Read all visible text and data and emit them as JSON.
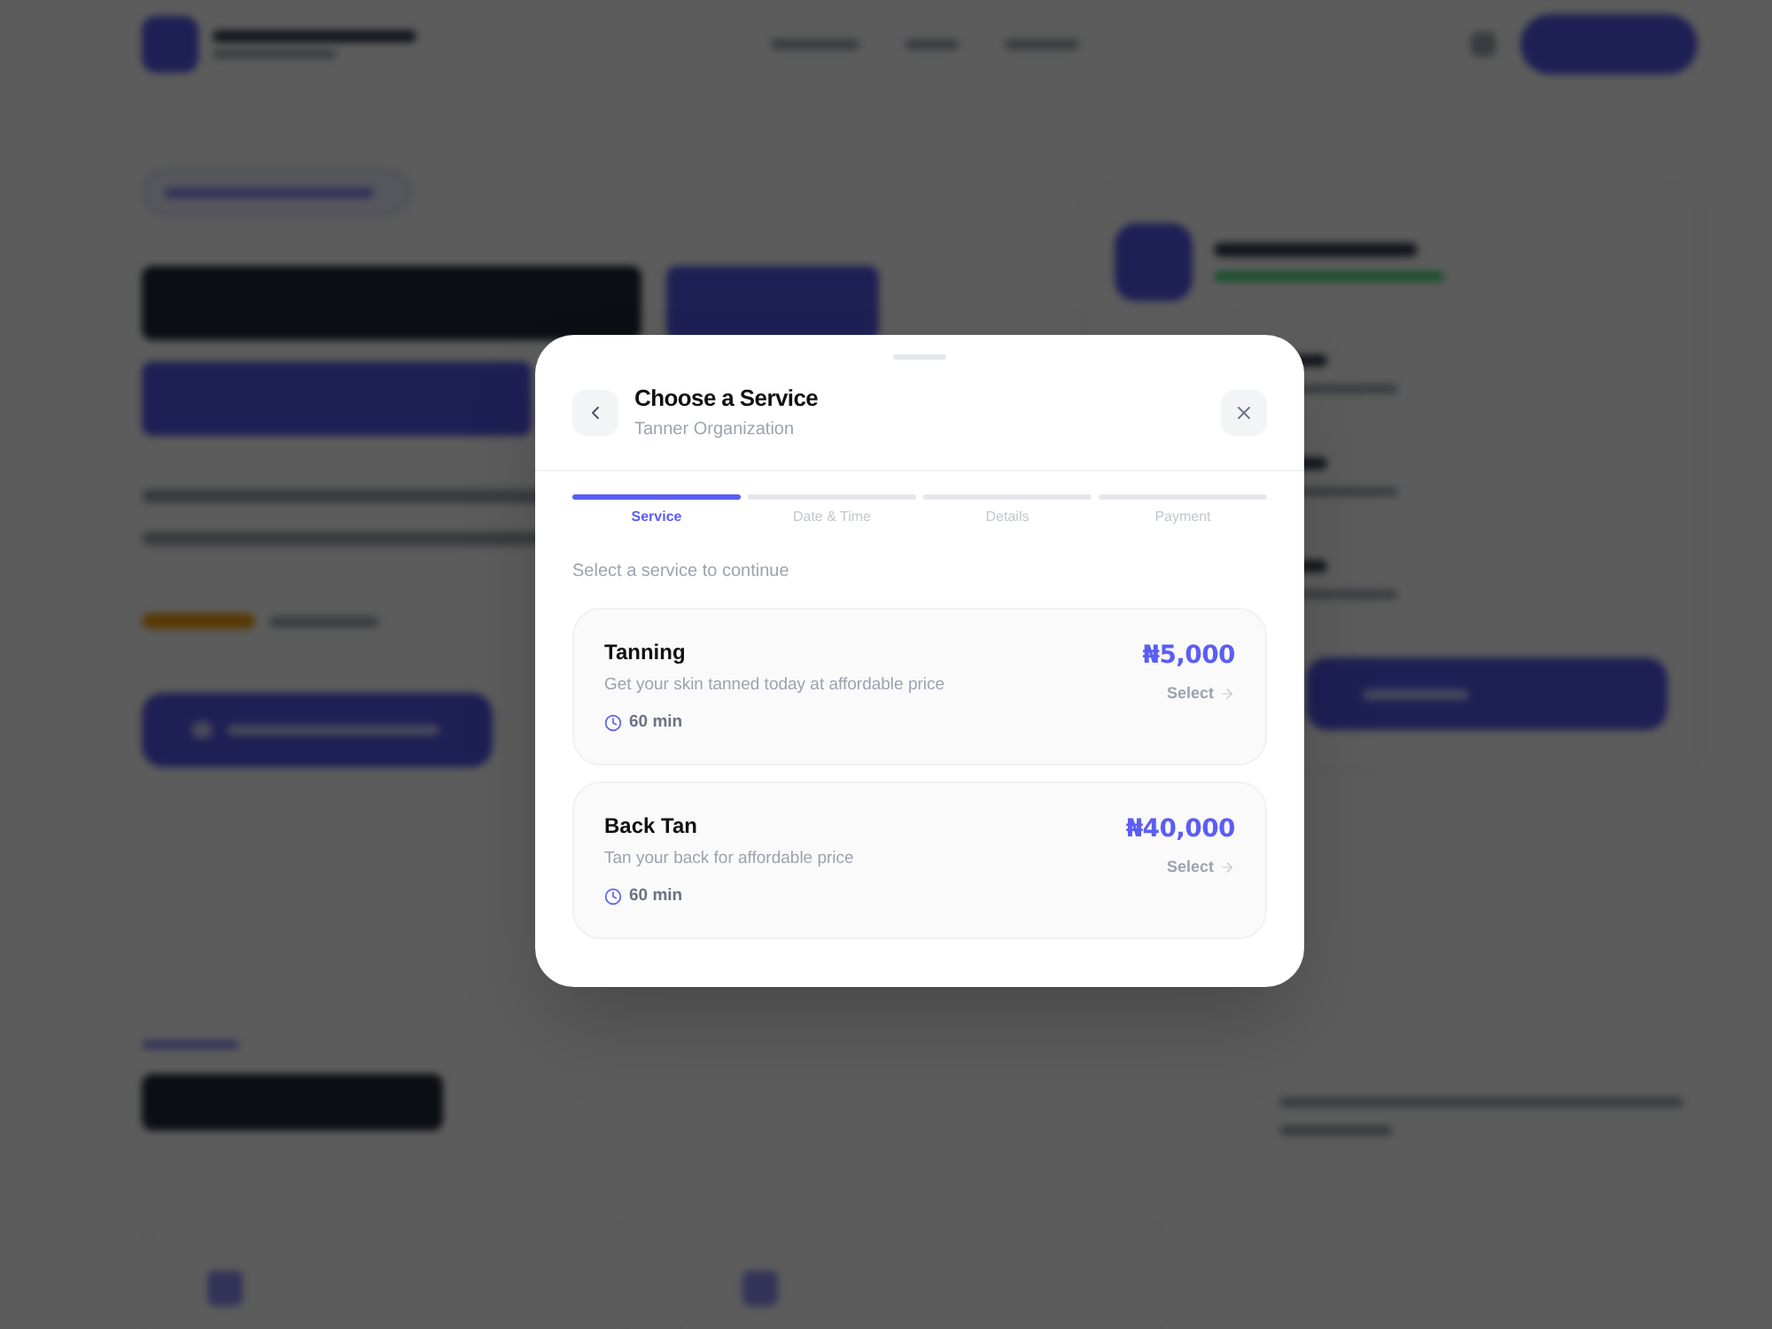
{
  "modal": {
    "title": "Choose a Service",
    "subtitle": "Tanner Organization",
    "steps": [
      {
        "label": "Service",
        "selected": true
      },
      {
        "label": "Date & Time",
        "selected": false
      },
      {
        "label": "Details",
        "selected": false
      },
      {
        "label": "Payment",
        "selected": false
      }
    ],
    "prompt": "Select a service to continue",
    "services": [
      {
        "name": "Tanning",
        "description": "Get your skin tanned today at affordable price",
        "duration": "60 min",
        "price": "₦5,000",
        "action": "Select"
      },
      {
        "name": "Back Tan",
        "description": "Tan your back for affordable price",
        "duration": "60 min",
        "price": "₦40,000",
        "action": "Select"
      }
    ]
  }
}
